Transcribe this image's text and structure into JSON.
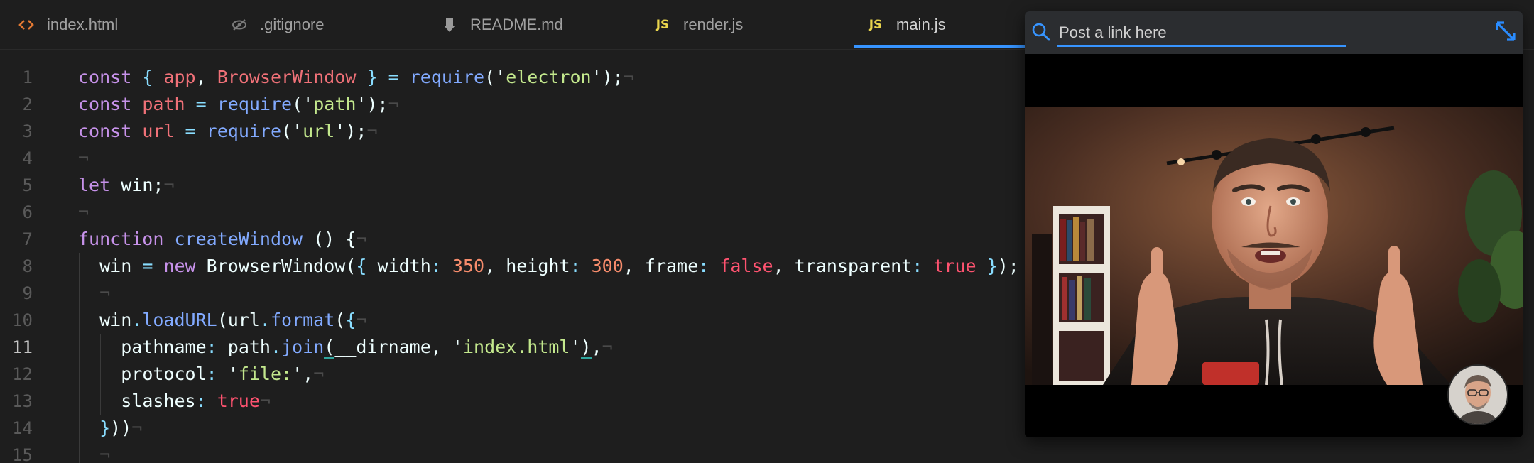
{
  "tabs": [
    {
      "label": "index.html",
      "icon": "html-icon",
      "active": false
    },
    {
      "label": ".gitignore",
      "icon": "eye-off-icon",
      "active": false
    },
    {
      "label": "README.md",
      "icon": "markdown-icon",
      "active": false
    },
    {
      "label": "render.js",
      "icon": "js-icon",
      "active": false
    },
    {
      "label": "main.js",
      "icon": "js-icon",
      "active": true
    }
  ],
  "js_badge": "JS",
  "editor": {
    "current_line": 11,
    "line_numbers": [
      "1",
      "2",
      "3",
      "4",
      "5",
      "6",
      "7",
      "8",
      "9",
      "10",
      "11",
      "12",
      "13",
      "14",
      "15"
    ]
  },
  "float": {
    "search_placeholder": "Post a link here",
    "search_value": ""
  },
  "colors": {
    "accent": "#3794ff",
    "tab_bg": "#1e1e1e",
    "editor_bg": "#1e1e1e",
    "js_yellow": "#e8d44d",
    "html_orange": "#e37933"
  }
}
